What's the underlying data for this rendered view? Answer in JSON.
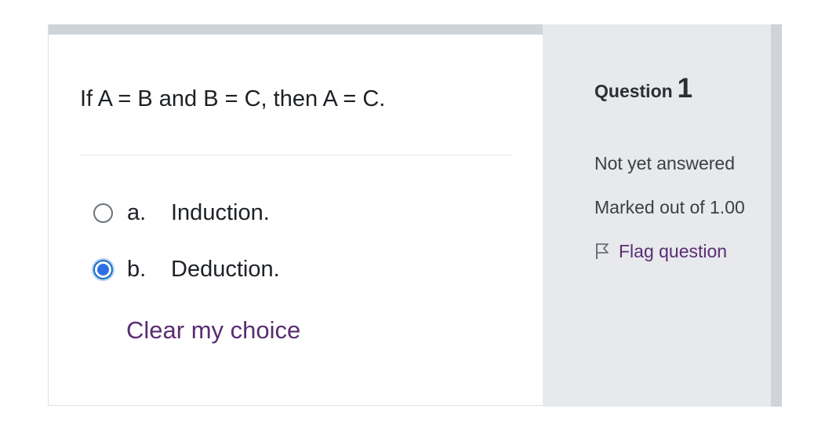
{
  "question": {
    "text": "If A = B and B = C, then A = C.",
    "options": [
      {
        "letter": "a.",
        "text": "Induction.",
        "selected": false
      },
      {
        "letter": "b.",
        "text": "Deduction.",
        "selected": true
      }
    ],
    "clear_choice_label": "Clear my choice"
  },
  "info": {
    "question_label": "Question",
    "question_number": "1",
    "state": "Not yet answered",
    "grade": "Marked out of 1.00",
    "flag_label": "Flag question",
    "flag_icon": "flag-outline-icon"
  },
  "colors": {
    "link": "#5a2d72",
    "radio_checked": "#2f6fe6",
    "info_bg": "#e7e9ec",
    "bar": "#ced4da"
  }
}
